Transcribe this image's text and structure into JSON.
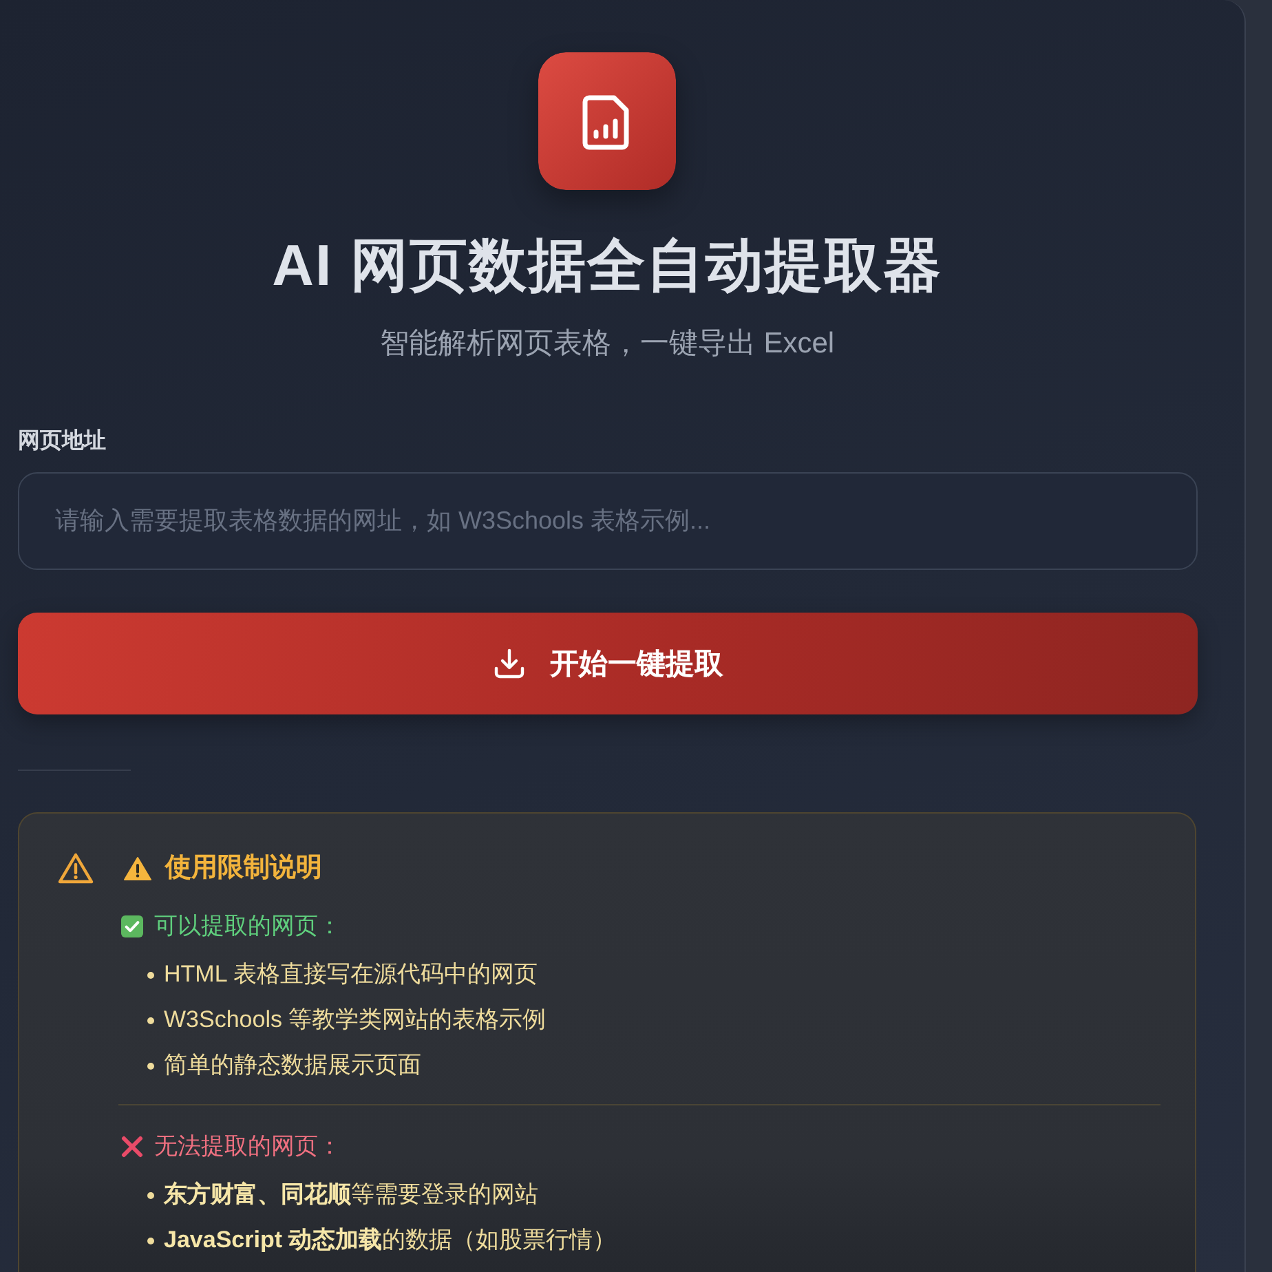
{
  "header": {
    "title": "AI 网页数据全自动提取器",
    "subtitle": "智能解析网页表格，一键导出 Excel"
  },
  "url_field": {
    "label": "网页地址",
    "placeholder": "请输入需要提取表格数据的网址，如 W3Schools 表格示例..."
  },
  "extract_button": {
    "label": "开始一键提取"
  },
  "notice": {
    "title": "使用限制说明",
    "sections": [
      {
        "kind": "allowed",
        "heading": "可以提取的网页：",
        "items": [
          "HTML 表格直接写在源代码中的网页",
          "W3Schools 等教学类网站的表格示例",
          "简单的静态数据展示页面"
        ]
      },
      {
        "kind": "blocked",
        "heading": "无法提取的网页：",
        "items": [
          "**东方财富、同花顺**等需要登录的网站",
          "**JavaScript 动态加载**的数据（如股票行情）"
        ]
      }
    ]
  }
}
